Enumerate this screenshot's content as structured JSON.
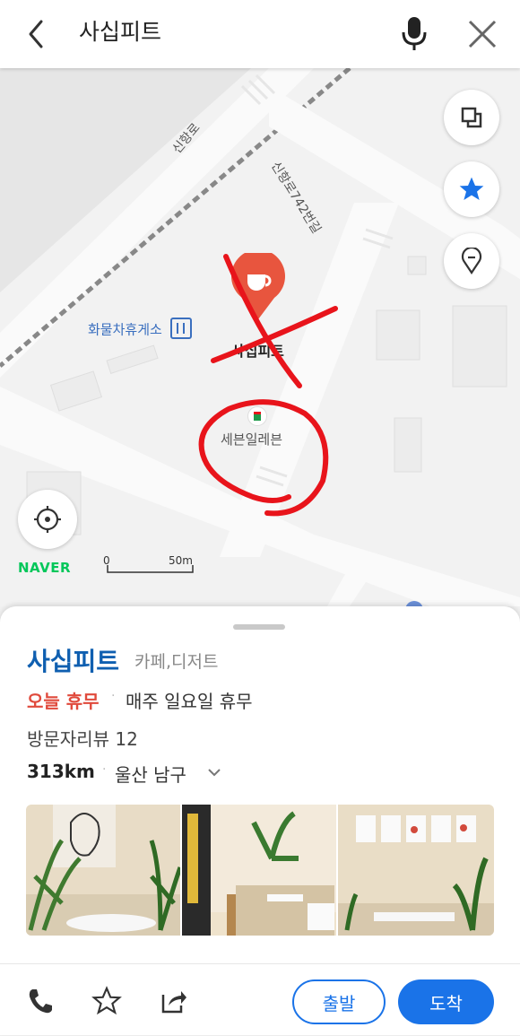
{
  "header": {
    "search_query": "사십피트"
  },
  "map": {
    "road_labels": [
      "신항로",
      "신항로742번길"
    ],
    "poi_rest_area": "화물차휴게소",
    "poi_selected": "사십피트",
    "poi_convenience": "세븐일레븐",
    "brand": "NAVER",
    "scale_start": "0",
    "scale_end": "50m"
  },
  "place": {
    "name": "사십피트",
    "category": "카페,디저트",
    "status": "오늘 휴무",
    "status_detail": "매주 일요일 휴무",
    "reviews": "방문자리뷰 12",
    "distance": "313km",
    "region": "울산 남구"
  },
  "actions": {
    "depart_label": "출발",
    "arrive_label": "도착"
  },
  "colors": {
    "brand_blue": "#1a73e8",
    "place_name": "#0f5fb0",
    "closed_red": "#e04a3c",
    "pin_red": "#e8553e",
    "naver_green": "#03c75a",
    "annotation_red": "#e8141b"
  },
  "icons": [
    "back-icon",
    "mic-icon",
    "close-icon",
    "layers-icon",
    "star-icon",
    "pin-outline-icon",
    "locate-icon",
    "phone-icon",
    "share-icon",
    "chevron-down-icon"
  ]
}
